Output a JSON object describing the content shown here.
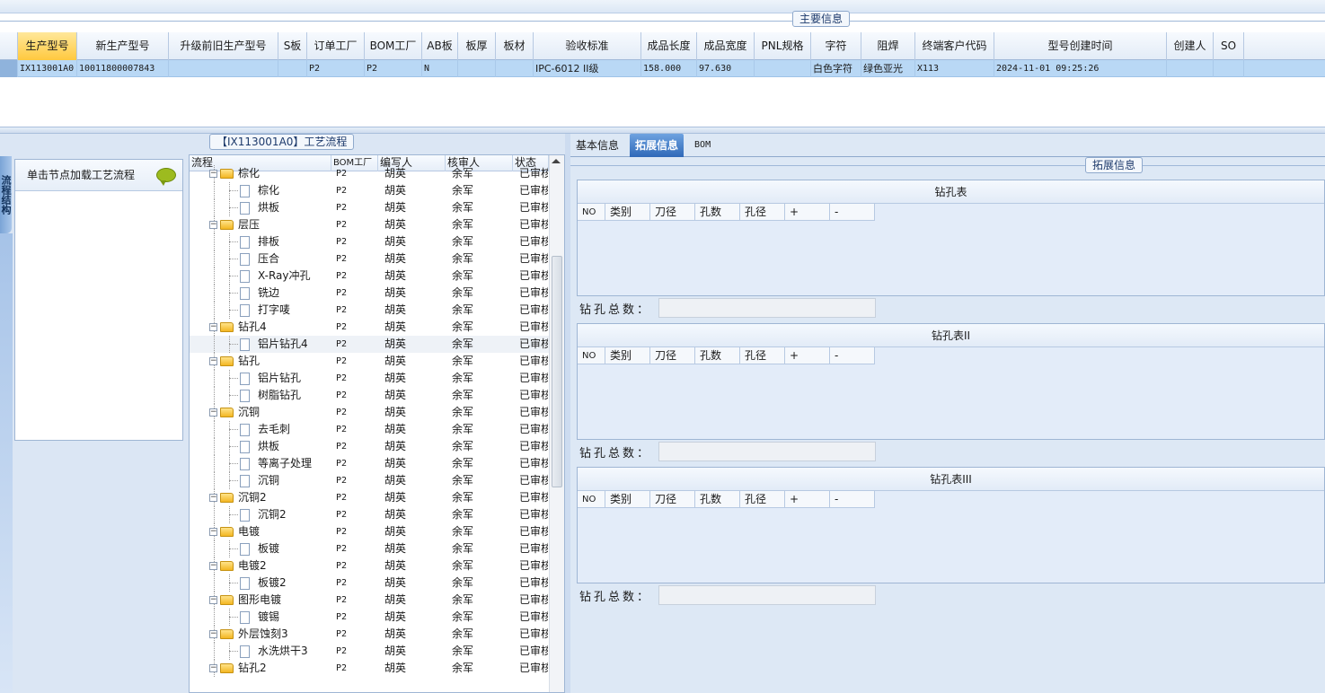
{
  "main_group": {
    "legend": "主要信息"
  },
  "grid": {
    "headers": [
      "生产型号",
      "新生产型号",
      "升级前旧生产型号",
      "S板",
      "订单工厂",
      "BOM工厂",
      "AB板",
      "板厚",
      "板材",
      "验收标准",
      "成品长度",
      "成品宽度",
      "PNL规格",
      "字符",
      "阻焊",
      "终端客户代码",
      "型号创建时间",
      "创建人",
      "SO"
    ],
    "row": [
      "IX113001A0",
      "10011800007843",
      "",
      "",
      "P2",
      "P2",
      "N",
      "",
      "",
      "IPC-6012 II级",
      "158.000",
      "97.630",
      "",
      "白色字符",
      "绿色亚光",
      "X113",
      "2024-11-01 09:25:26",
      "",
      ""
    ]
  },
  "left": {
    "process_legend": "【IX113001A0】工艺流程",
    "vertical_tab": "流程结构",
    "node_hint": "单击节点加载工艺流程",
    "tree_headers": [
      "流程",
      "BOM工厂",
      "编写人",
      "核审人",
      "状态"
    ],
    "tree_rows": [
      {
        "level": 1,
        "name": "棕化",
        "bom": "P2",
        "writer": "胡英",
        "reviewer": "余军",
        "status": "已审核"
      },
      {
        "level": 2,
        "name": "棕化",
        "bom": "P2",
        "writer": "胡英",
        "reviewer": "余军",
        "status": "已审核"
      },
      {
        "level": 2,
        "name": "烘板",
        "bom": "P2",
        "writer": "胡英",
        "reviewer": "余军",
        "status": "已审核"
      },
      {
        "level": 1,
        "name": "层压",
        "bom": "P2",
        "writer": "胡英",
        "reviewer": "余军",
        "status": "已审核"
      },
      {
        "level": 2,
        "name": "排板",
        "bom": "P2",
        "writer": "胡英",
        "reviewer": "余军",
        "status": "已审核"
      },
      {
        "level": 2,
        "name": "压合",
        "bom": "P2",
        "writer": "胡英",
        "reviewer": "余军",
        "status": "已审核"
      },
      {
        "level": 2,
        "name": "X-Ray冲孔",
        "bom": "P2",
        "writer": "胡英",
        "reviewer": "余军",
        "status": "已审核"
      },
      {
        "level": 2,
        "name": "铣边",
        "bom": "P2",
        "writer": "胡英",
        "reviewer": "余军",
        "status": "已审核"
      },
      {
        "level": 2,
        "name": "打字唛",
        "bom": "P2",
        "writer": "胡英",
        "reviewer": "余军",
        "status": "已审核"
      },
      {
        "level": 1,
        "name": "钻孔4",
        "bom": "P2",
        "writer": "胡英",
        "reviewer": "余军",
        "status": "已审核"
      },
      {
        "level": 2,
        "name": "铝片钻孔4",
        "bom": "P2",
        "writer": "胡英",
        "reviewer": "余军",
        "status": "已审核",
        "highlight": true
      },
      {
        "level": 1,
        "name": "钻孔",
        "bom": "P2",
        "writer": "胡英",
        "reviewer": "余军",
        "status": "已审核"
      },
      {
        "level": 2,
        "name": "铝片钻孔",
        "bom": "P2",
        "writer": "胡英",
        "reviewer": "余军",
        "status": "已审核"
      },
      {
        "level": 2,
        "name": "树脂钻孔",
        "bom": "P2",
        "writer": "胡英",
        "reviewer": "余军",
        "status": "已审核"
      },
      {
        "level": 1,
        "name": "沉铜",
        "bom": "P2",
        "writer": "胡英",
        "reviewer": "余军",
        "status": "已审核"
      },
      {
        "level": 2,
        "name": "去毛刺",
        "bom": "P2",
        "writer": "胡英",
        "reviewer": "余军",
        "status": "已审核"
      },
      {
        "level": 2,
        "name": "烘板",
        "bom": "P2",
        "writer": "胡英",
        "reviewer": "余军",
        "status": "已审核"
      },
      {
        "level": 2,
        "name": "等离子处理",
        "bom": "P2",
        "writer": "胡英",
        "reviewer": "余军",
        "status": "已审核"
      },
      {
        "level": 2,
        "name": "沉铜",
        "bom": "P2",
        "writer": "胡英",
        "reviewer": "余军",
        "status": "已审核"
      },
      {
        "level": 1,
        "name": "沉铜2",
        "bom": "P2",
        "writer": "胡英",
        "reviewer": "余军",
        "status": "已审核"
      },
      {
        "level": 2,
        "name": "沉铜2",
        "bom": "P2",
        "writer": "胡英",
        "reviewer": "余军",
        "status": "已审核"
      },
      {
        "level": 1,
        "name": "电镀",
        "bom": "P2",
        "writer": "胡英",
        "reviewer": "余军",
        "status": "已审核"
      },
      {
        "level": 2,
        "name": "板镀",
        "bom": "P2",
        "writer": "胡英",
        "reviewer": "余军",
        "status": "已审核"
      },
      {
        "level": 1,
        "name": "电镀2",
        "bom": "P2",
        "writer": "胡英",
        "reviewer": "余军",
        "status": "已审核"
      },
      {
        "level": 2,
        "name": "板镀2",
        "bom": "P2",
        "writer": "胡英",
        "reviewer": "余军",
        "status": "已审核"
      },
      {
        "level": 1,
        "name": "图形电镀",
        "bom": "P2",
        "writer": "胡英",
        "reviewer": "余军",
        "status": "已审核"
      },
      {
        "level": 2,
        "name": "镀锡",
        "bom": "P2",
        "writer": "胡英",
        "reviewer": "余军",
        "status": "已审核"
      },
      {
        "level": 1,
        "name": "外层蚀刻3",
        "bom": "P2",
        "writer": "胡英",
        "reviewer": "余军",
        "status": "已审核"
      },
      {
        "level": 2,
        "name": "水洗烘干3",
        "bom": "P2",
        "writer": "胡英",
        "reviewer": "余军",
        "status": "已审核"
      },
      {
        "level": 1,
        "name": "钻孔2",
        "bom": "P2",
        "writer": "胡英",
        "reviewer": "余军",
        "status": "已审核"
      }
    ]
  },
  "right": {
    "tabs": [
      "基本信息",
      "拓展信息",
      "BOM"
    ],
    "active_tab": "拓展信息",
    "ext_legend": "拓展信息",
    "drill_headers": [
      "NO",
      "类别",
      "刀径",
      "孔数",
      "孔径",
      "+",
      "-"
    ],
    "drill_total_label": "钻孔总数：",
    "drill_tables": [
      {
        "title": "钻孔表"
      },
      {
        "title": "钻孔表II"
      },
      {
        "title": "钻孔表III"
      }
    ]
  },
  "colors": {
    "selection": "#b9d8f5",
    "active_header": "#ffc93f",
    "active_tab": "#2f69b8"
  }
}
